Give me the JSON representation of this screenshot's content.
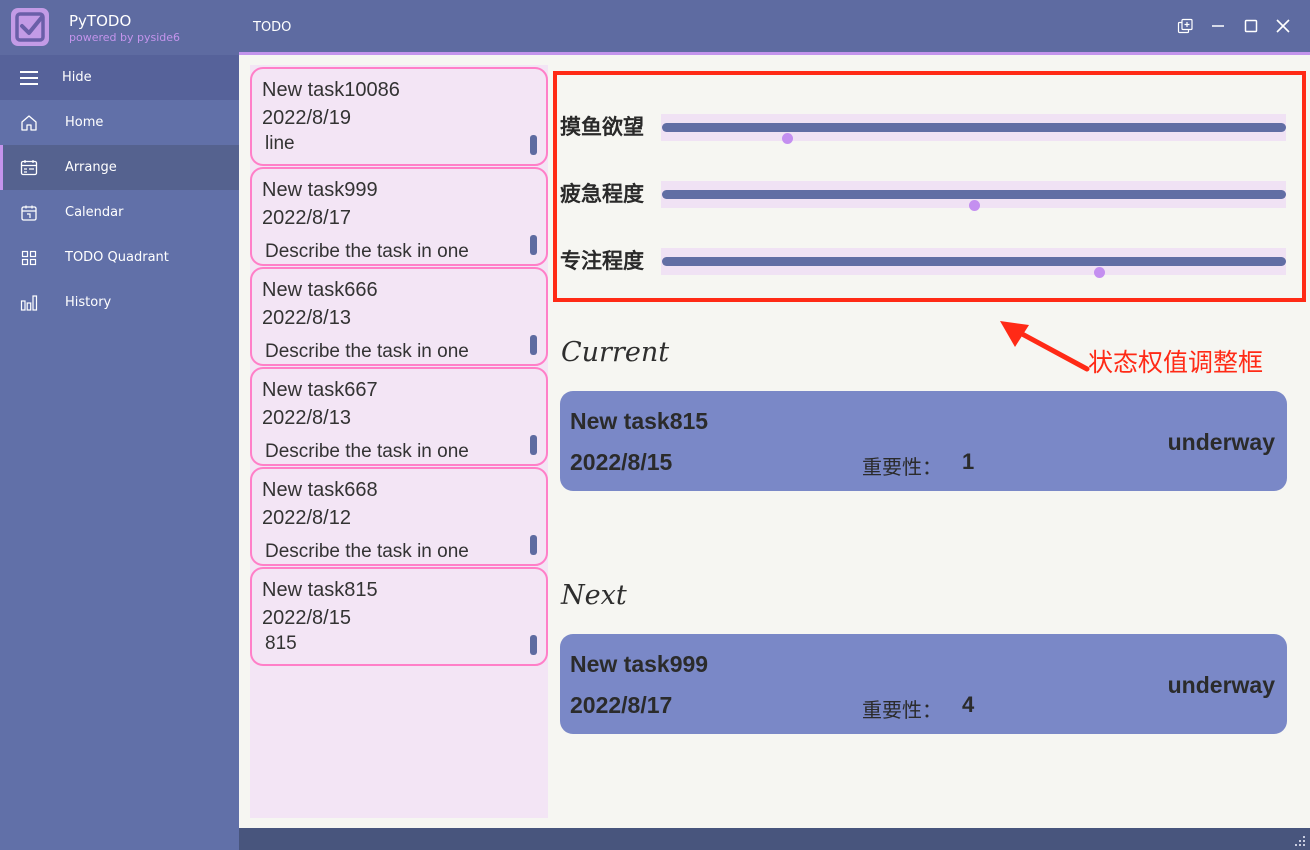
{
  "app": {
    "title": "PyTODO",
    "subtitle": "powered by pyside6",
    "window_title": "TODO"
  },
  "sidebar": {
    "items": [
      {
        "label": "Hide",
        "icon": "menu-icon"
      },
      {
        "label": "Home",
        "icon": "home-icon"
      },
      {
        "label": "Arrange",
        "icon": "arrange-icon",
        "selected": true
      },
      {
        "label": "Calendar",
        "icon": "calendar-icon"
      },
      {
        "label": "TODO Quadrant",
        "icon": "grid-icon"
      },
      {
        "label": "History",
        "icon": "bar-chart-icon"
      }
    ]
  },
  "window_controls": [
    "new-window-icon",
    "minimize-icon",
    "maximize-icon",
    "close-icon"
  ],
  "tasks": [
    {
      "name": "New task10086",
      "date": "2022/8/19",
      "desc": "line"
    },
    {
      "name": "New task999",
      "date": "2022/8/17",
      "desc": "Describe the task in one"
    },
    {
      "name": "New task666",
      "date": "2022/8/13",
      "desc": "Describe the task in one"
    },
    {
      "name": "New task667",
      "date": "2022/8/13",
      "desc": "Describe the task in one"
    },
    {
      "name": "New task668",
      "date": "2022/8/12",
      "desc": "Describe the task in one"
    },
    {
      "name": "New task815",
      "date": "2022/8/15",
      "desc": "815"
    }
  ],
  "sliders": [
    {
      "label": "摸鱼欲望",
      "value": 0.2
    },
    {
      "label": "疲急程度",
      "value": 0.5
    },
    {
      "label": "专注程度",
      "value": 0.7
    }
  ],
  "annotation": "状态权值调整框",
  "current": {
    "heading": "Current",
    "name": "New task815",
    "date": "2022/8/15",
    "importance_label": "重要性：",
    "importance": "1",
    "status": "underway"
  },
  "next": {
    "heading": "Next",
    "name": "New task999",
    "date": "2022/8/17",
    "importance_label": "重要性：",
    "importance": "4",
    "status": "underway"
  },
  "colors": {
    "sidebar": "#6170a8",
    "accent": "#c394ec",
    "card_border": "#ff7fc8",
    "card_bg": "#f3e5f5",
    "big_card": "#7a88c7",
    "annotation": "#ff2a16"
  }
}
